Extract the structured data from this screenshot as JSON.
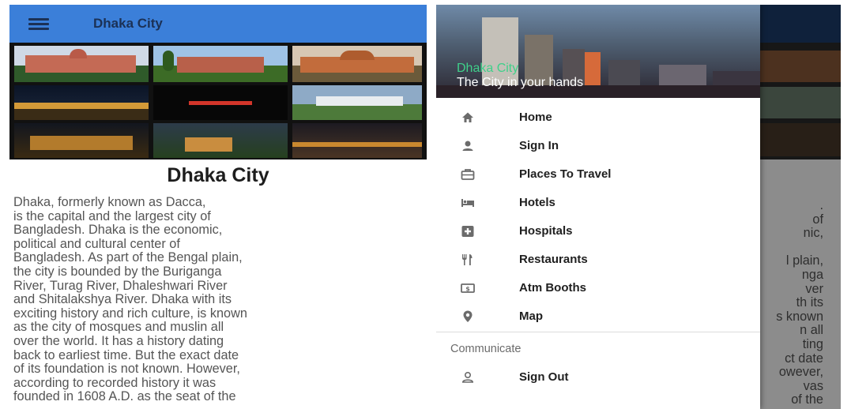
{
  "left_screen": {
    "appbar": {
      "title": "Dhaka City",
      "menu_icon": "hamburger-menu-icon",
      "color": "#3b7fd9"
    },
    "gallery": {
      "tile_count": 9
    },
    "article": {
      "title": "Dhaka City",
      "body": "Dhaka, formerly known as Dacca,\nis the capital and the largest city of\nBangladesh. Dhaka is the economic,\npolitical and cultural center of\nBangladesh. As part of the Bengal plain,\nthe city is bounded by the Buriganga\nRiver, Turag River, Dhaleshwari River\nand Shitalakshya River. Dhaka with its\nexciting history and rich culture, is known\nas the city of mosques and muslin all\nover the world. It has a history dating\nback to earliest time. But the exact date\nof its foundation is not known. However,\naccording to recorded history it was\nfounded in 1608 A.D. as the seat of the"
    }
  },
  "right_screen": {
    "background_body": ".\nof\nnic,\n\nl plain,\nnga\nver\nth its\ns known\nn all\nting\nct date\nowever,\nvas\nof the",
    "drawer": {
      "header": {
        "title": "Dhaka City",
        "subtitle": "The City in your hands",
        "title_color": "#3fd08a"
      },
      "items": [
        {
          "label": "Home",
          "icon": "home-icon"
        },
        {
          "label": "Sign In",
          "icon": "person-icon"
        },
        {
          "label": "Places To Travel",
          "icon": "briefcase-icon"
        },
        {
          "label": "Hotels",
          "icon": "hotel-bed-icon"
        },
        {
          "label": "Hospitals",
          "icon": "hospital-plus-icon"
        },
        {
          "label": "Restaurants",
          "icon": "restaurant-icon"
        },
        {
          "label": "Atm Booths",
          "icon": "atm-money-icon"
        },
        {
          "label": "Map",
          "icon": "map-pin-icon"
        }
      ],
      "section": "Communicate",
      "section_items": [
        {
          "label": "Sign Out",
          "icon": "person-outline-icon"
        }
      ]
    }
  }
}
